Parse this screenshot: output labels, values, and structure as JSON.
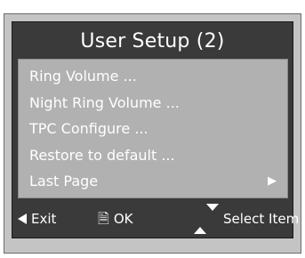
{
  "osd": {
    "title": "User Setup  (2)",
    "background_color": "#3a3a3a",
    "panel_color": "#b1b1b1",
    "text_color": "#ffffff"
  },
  "menu": {
    "items": [
      {
        "label": "Ring Volume ...",
        "icon": ""
      },
      {
        "label": "Night Ring Volume ...",
        "icon": ""
      },
      {
        "label": "TPC Configure ...",
        "icon": ""
      },
      {
        "label": "Restore to default ...",
        "icon": ""
      },
      {
        "label": "Last Page",
        "icon": "right-triangle-icon",
        "arrow": "▶"
      }
    ]
  },
  "footer": {
    "exit_label": "Exit",
    "exit_icon": "left-triangle-icon",
    "ok_label": "OK",
    "ok_icon": "document-icon",
    "ok_glyph": "🗎",
    "select_label": "Select Item",
    "select_icon": "up-down-icon"
  }
}
